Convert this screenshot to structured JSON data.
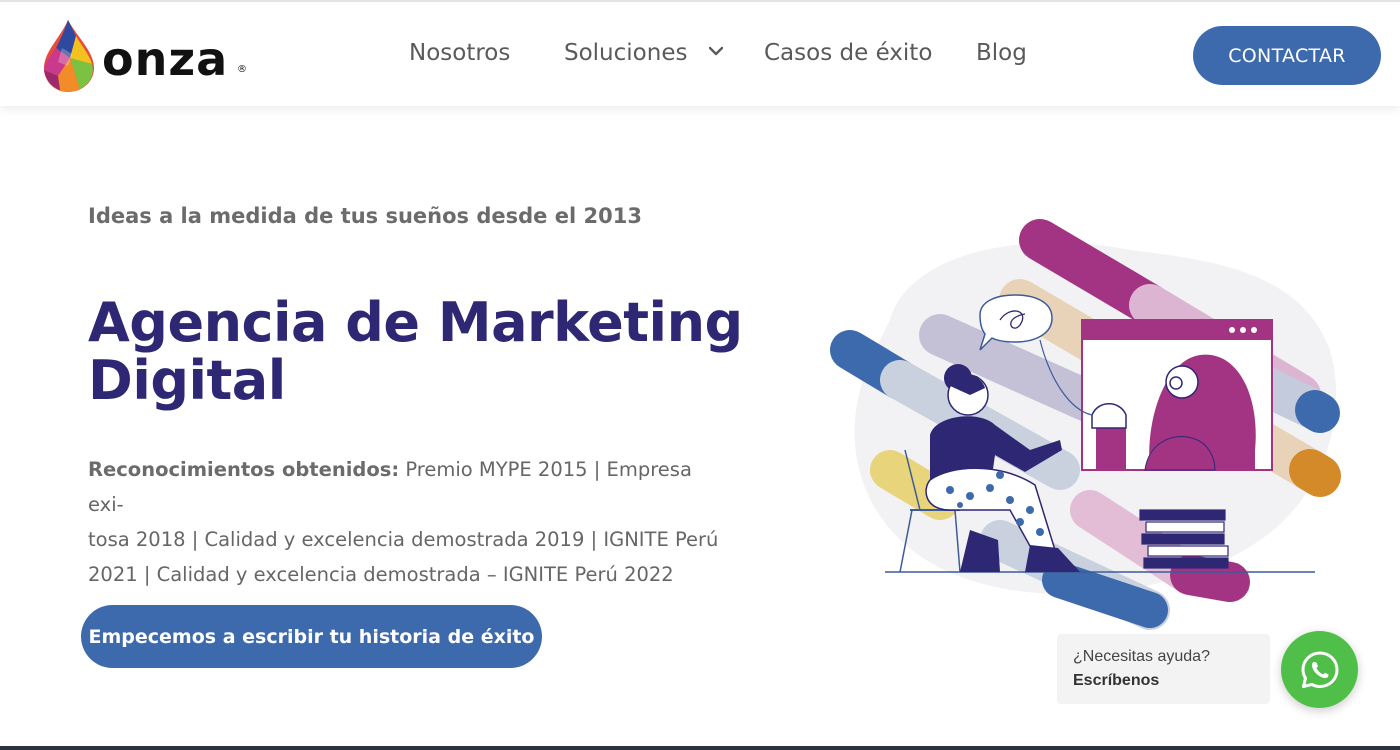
{
  "header": {
    "logo_text": "onza",
    "logo_mark": "®",
    "nav": [
      {
        "label": "Nosotros"
      },
      {
        "label": "Soluciones"
      },
      {
        "label": "Casos de éxito"
      },
      {
        "label": "Blog"
      }
    ],
    "cta_label": "CONTACTAR"
  },
  "hero": {
    "tagline": "Ideas a la medida de tus sueños desde el 2013",
    "title_line1": "Agencia de Marketing",
    "title_line2": "Digital",
    "awards_label": "Reconocimientos obtenidos:",
    "awards_line1": "Premio MYPE 2015 | Empresa exi-",
    "awards_line2": "tosa 2018 | Calidad y excelencia demostrada 2019 | IGNITE Perú",
    "awards_line3": "2021 | Calidad y excelencia demostrada – IGNITE Perú 2022",
    "button_label": "Empecemos a escribir tu historia de éxito"
  },
  "chat": {
    "question": "¿Necesitas ayuda?",
    "action": "Escríbenos"
  },
  "colors": {
    "primary_blue": "#3d6aad",
    "title_purple": "#2e2874",
    "magenta": "#a33483",
    "whatsapp_green": "#4fbf4a"
  },
  "icons": {
    "nav_dropdown": "chevron-down-icon",
    "chat": "whatsapp-icon",
    "logo": "drop-logo-icon"
  }
}
